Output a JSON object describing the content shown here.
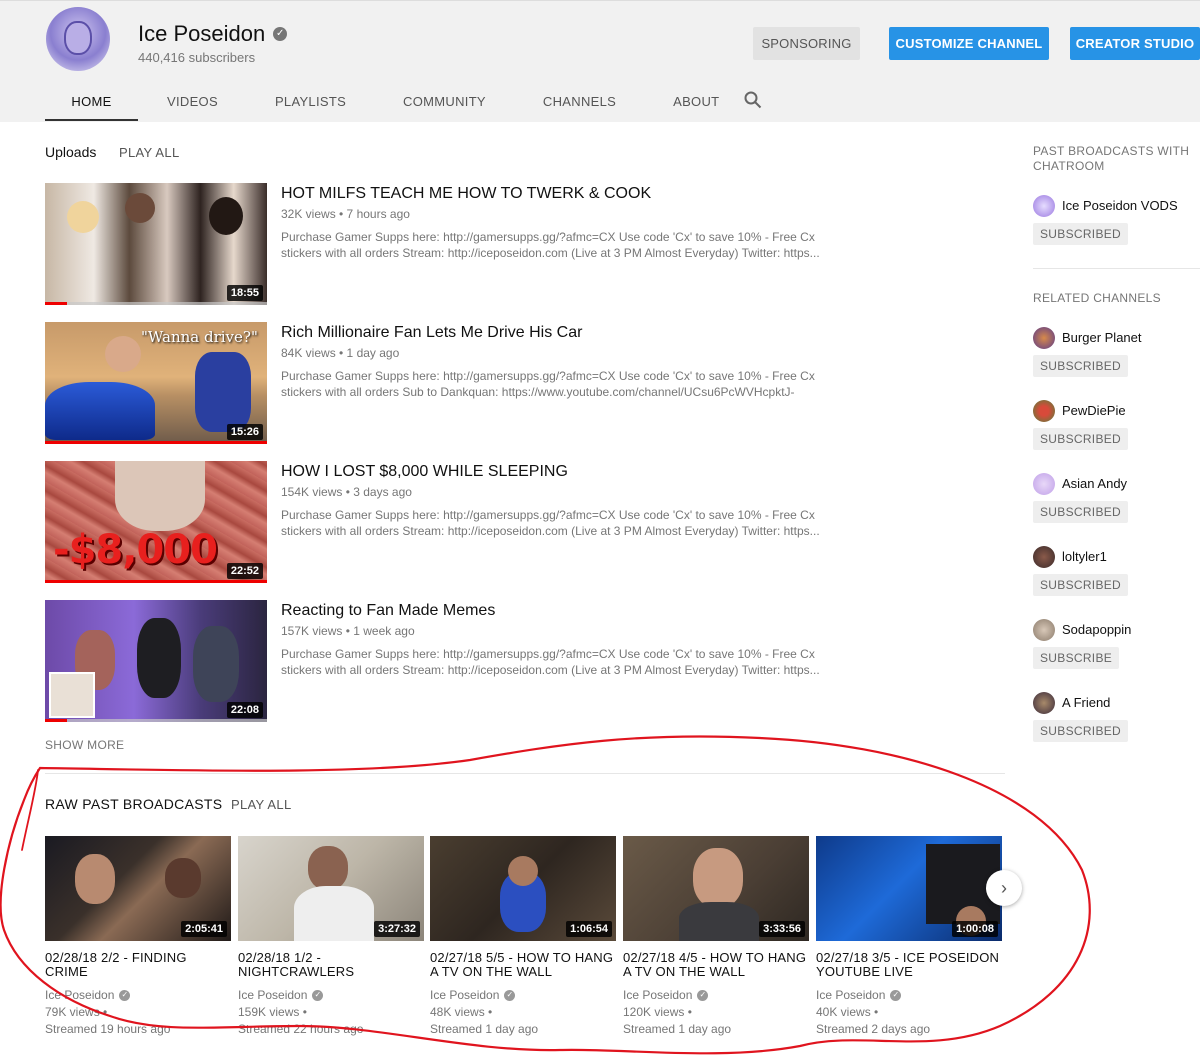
{
  "channel": {
    "name": "Ice Poseidon",
    "subscribers": "440,416 subscribers",
    "buttons": {
      "sponsoring": "SPONSORING",
      "customize": "CUSTOMIZE CHANNEL",
      "studio": "CREATOR STUDIO"
    },
    "tabs": [
      "HOME",
      "VIDEOS",
      "PLAYLISTS",
      "COMMUNITY",
      "CHANNELS",
      "ABOUT"
    ],
    "active_tab": "HOME"
  },
  "uploads": {
    "title": "Uploads",
    "play_all": "PLAY ALL",
    "show_more": "SHOW MORE",
    "videos": [
      {
        "title": "HOT MILFS TEACH ME HOW TO TWERK & COOK",
        "meta": "32K views • 7 hours ago",
        "duration": "18:55",
        "desc": "Purchase Gamer Supps here: http://gamersupps.gg/?afmc=CX Use code 'Cx' to save 10% - Free Cx stickers with all orders Stream: http://iceposeidon.com (Live at 3 PM Almost Everyday) Twitter: https...",
        "watched": 0.1
      },
      {
        "title": "Rich Millionaire Fan Lets Me Drive His Car",
        "meta": "84K views • 1 day ago",
        "duration": "15:26",
        "thumb_text": "\"Wanna drive?\"",
        "desc": "Purchase Gamer Supps here: http://gamersupps.gg/?afmc=CX Use code 'Cx' to save 10% - Free Cx stickers with all orders Sub to Dankquan: https://www.youtube.com/channel/UCsu6PcWVHcpktJ-",
        "watched": 1.0
      },
      {
        "title": "HOW I LOST $8,000 WHILE SLEEPING",
        "meta": "154K views • 3 days ago",
        "duration": "22:52",
        "thumb_text": "-$8,000",
        "desc": "Purchase Gamer Supps here: http://gamersupps.gg/?afmc=CX Use code 'Cx' to save 10% - Free Cx stickers with all orders Stream: http://iceposeidon.com (Live at 3 PM Almost Everyday) Twitter: https...",
        "watched": 1.0
      },
      {
        "title": "Reacting to Fan Made Memes",
        "meta": "157K views • 1 week ago",
        "duration": "22:08",
        "desc": "Purchase Gamer Supps here: http://gamersupps.gg/?afmc=CX Use code 'Cx' to save 10% - Free Cx stickers with all orders Stream: http://iceposeidon.com (Live at 3 PM Almost Everyday) Twitter: https...",
        "watched": 0.1
      }
    ]
  },
  "broadcasts": {
    "title": "RAW PAST BROADCASTS",
    "play_all": "PLAY ALL",
    "items": [
      {
        "title": "02/28/18 2/2 - FINDING CRIME",
        "channel": "Ice Poseidon",
        "views": "79K views •",
        "when": "Streamed 19 hours ago",
        "duration": "2:05:41"
      },
      {
        "title": "02/28/18 1/2 - NIGHTCRAWLERS",
        "channel": "Ice Poseidon",
        "views": "159K views •",
        "when": "Streamed 22 hours ago",
        "duration": "3:27:32"
      },
      {
        "title": "02/27/18 5/5 - HOW TO HANG A TV ON THE WALL",
        "channel": "Ice Poseidon",
        "views": "48K views •",
        "when": "Streamed 1 day ago",
        "duration": "1:06:54"
      },
      {
        "title": "02/27/18 4/5 - HOW TO HANG A TV ON THE WALL",
        "channel": "Ice Poseidon",
        "views": "120K views •",
        "when": "Streamed 1 day ago",
        "duration": "3:33:56"
      },
      {
        "title": "02/27/18 3/5 - ICE POSEIDON YOUTUBE LIVE",
        "channel": "Ice Poseidon",
        "views": "40K views •",
        "when": "Streamed 2 days ago",
        "duration": "1:00:08"
      }
    ]
  },
  "sidebar": {
    "past_heading": "PAST BROADCASTS WITH CHATROOM",
    "past_channel": {
      "name": "Ice Poseidon VODS",
      "button": "SUBSCRIBED"
    },
    "related_heading": "RELATED CHANNELS",
    "related": [
      {
        "name": "Burger Planet",
        "button": "SUBSCRIBED"
      },
      {
        "name": "PewDiePie",
        "button": "SUBSCRIBED"
      },
      {
        "name": "Asian Andy",
        "button": "SUBSCRIBED"
      },
      {
        "name": "loltyler1",
        "button": "SUBSCRIBED"
      },
      {
        "name": "Sodapoppin",
        "button": "SUBSCRIBE"
      },
      {
        "name": "A Friend",
        "button": "SUBSCRIBED"
      }
    ]
  },
  "colors": {
    "accent_blue": "#2793e6",
    "annotation_red": "#e0141e",
    "progress_red": "#ee0000"
  },
  "icons": {
    "search": "search-icon",
    "verified": "verified-icon",
    "next": "chevron-right-icon"
  }
}
